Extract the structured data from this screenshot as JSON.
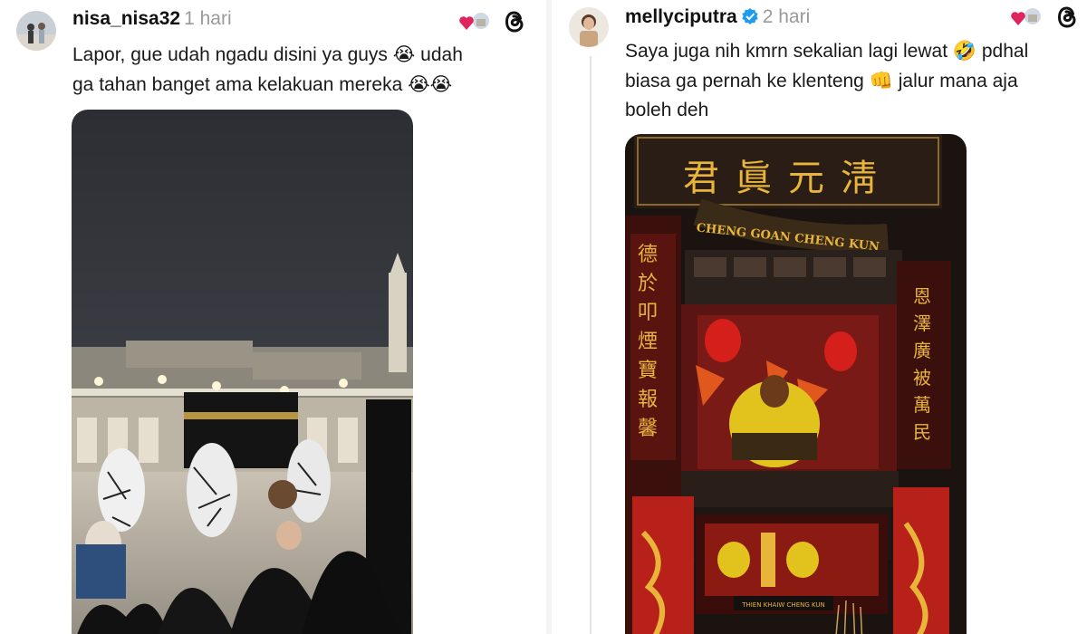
{
  "left_post": {
    "username": "nisa_nisa32",
    "timestamp": "1 hari",
    "text_line_1": "Lapor, gue udah ngadu disini ya guys",
    "text_line_1_end": "udah",
    "text_line_2": "ga tahan banget ama kelakuan mereka",
    "emoji_sob": "😭",
    "icons": {
      "avatar": "user-avatar",
      "reaction": "heart-reaction-icon",
      "threads": "threads-logo-icon"
    }
  },
  "right_post": {
    "username": "mellyciputra",
    "timestamp": "2 hari",
    "text_line_1": "Saya juga nih kmrn sekalian lagi lewat",
    "text_line_1_end": "pdhal",
    "text_line_2": "biasa ga pernah ke klenteng",
    "text_line_2_end": "jalur mana aja",
    "text_line_3": "boleh deh",
    "emoji_laugh": "🤣",
    "emoji_fist": "👊",
    "icons": {
      "avatar": "user-avatar",
      "verified": "verified-badge-icon",
      "reaction": "heart-reaction-icon",
      "threads": "threads-logo-icon"
    }
  },
  "temple_image": {
    "hanzi_title": "君眞元淸",
    "banner_text": "CHENG GOAN CHENG KUN",
    "altar_plate_text": "THIEN KHAIW CHENG KUN"
  },
  "colors": {
    "heart": "#e0245e",
    "verified": "#1d9bf0",
    "timestamp": "#9a9a9a",
    "temple_red": "#c0241c",
    "temple_gold": "#e8b53a"
  }
}
